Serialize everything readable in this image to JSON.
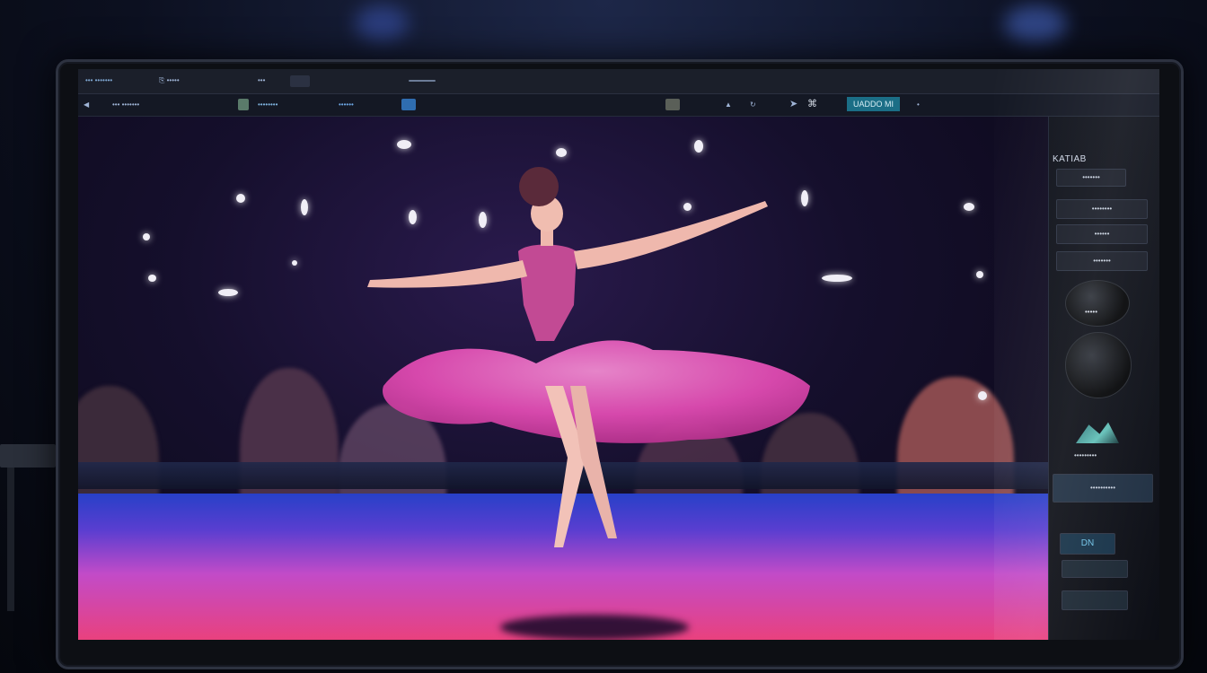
{
  "topbar": {
    "title": "••• •••••••",
    "items": [
      "⎘ •••••",
      "•••"
    ]
  },
  "toolbar": {
    "items": [
      "••• •••••••",
      "••••••••",
      "••••••"
    ],
    "upload_label": "UADDO MI"
  },
  "right_panel": {
    "title": "KATIAB",
    "buttons": [
      "•••••••",
      "••••••••",
      "••••••",
      "•••••••"
    ],
    "thumb_label": "•••••",
    "preset_label": "•••••••••",
    "apply_label": "••••••••••",
    "ok_label": "DN"
  },
  "colors": {
    "accent": "#2f7fa8",
    "dress": "#e04bb2",
    "stage_pink": "#e9417e",
    "stage_blue": "#2740c8"
  }
}
